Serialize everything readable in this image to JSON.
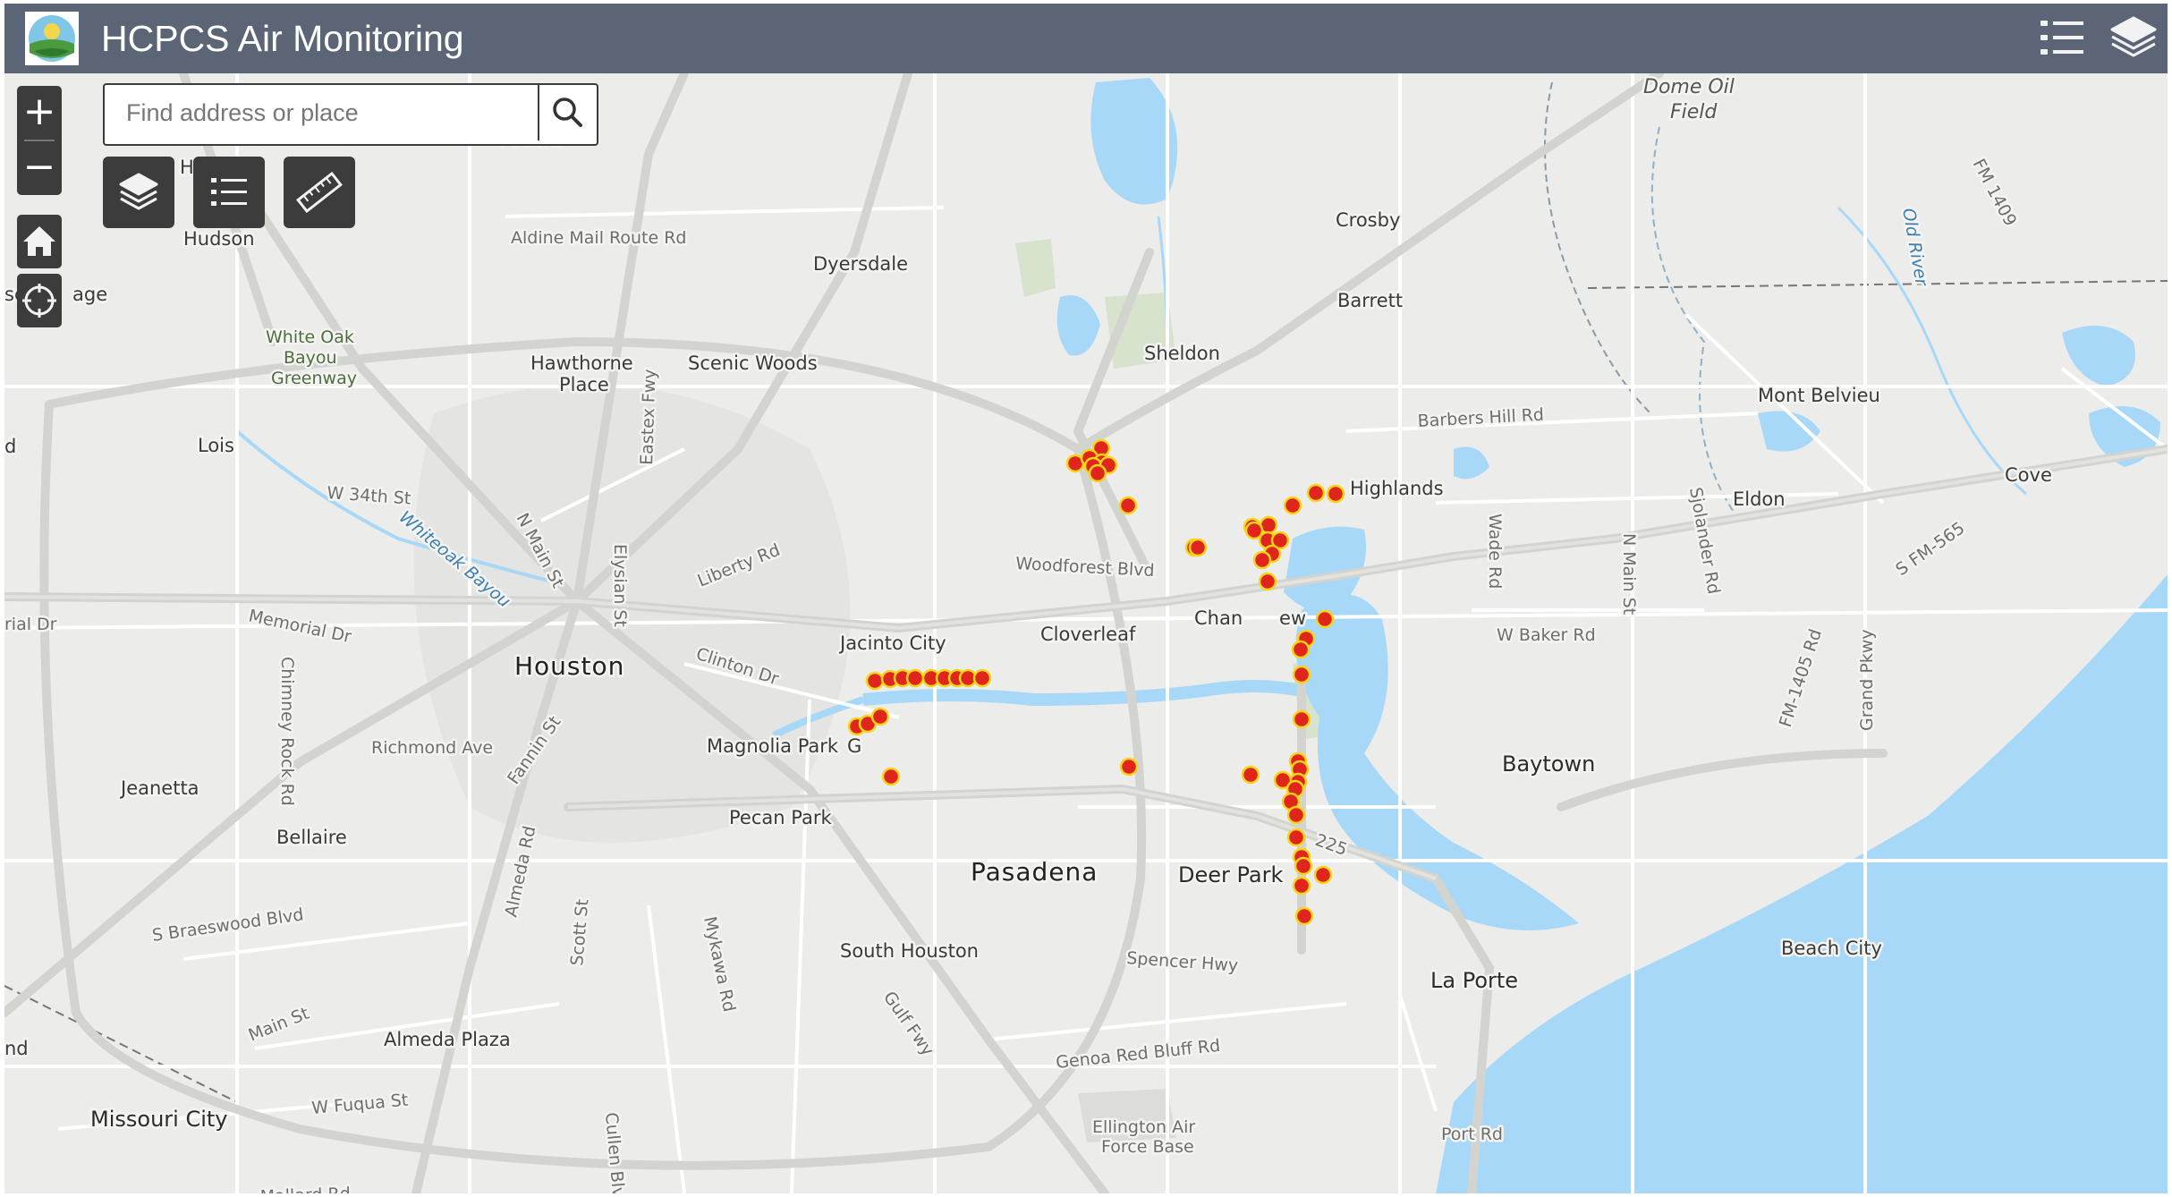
{
  "header": {
    "title": "HCPCS Air Monitoring",
    "bg_color": "#5b6576",
    "logo_icon": "hcpcs-logo",
    "legend_icon": "list-icon",
    "layers_icon": "layers-icon"
  },
  "search": {
    "placeholder": "Find address or place",
    "icon": "search-icon"
  },
  "zoom": {
    "in_label": "+",
    "out_label": "−"
  },
  "tools": [
    {
      "name": "layers",
      "icon": "layers-icon"
    },
    {
      "name": "legend",
      "icon": "list-icon"
    },
    {
      "name": "measure",
      "icon": "ruler-icon"
    }
  ],
  "nav": {
    "home_icon": "home-icon",
    "locate_icon": "locate-icon"
  },
  "map": {
    "marker_color": "#e0261c",
    "water_color": "#a8d8f8",
    "labels": {
      "houston": "Houston",
      "pasadena": "Pasadena",
      "deer_park": "Deer Park",
      "baytown": "Baytown",
      "la_porte": "La Porte",
      "hudson": "Hudson",
      "dyersdale": "Dyersdale",
      "crosby": "Crosby",
      "barrett": "Barrett",
      "sheldon": "Sheldon",
      "mont_belvieu": "Mont Belvieu",
      "highlands": "Highlands",
      "eldon": "Eldon",
      "cove": "Cove",
      "hawthorne": "Hawthorne",
      "place": "Place",
      "scenic_woods": "Scenic Woods",
      "lois": "Lois",
      "jacinto_city": "Jacinto City",
      "cloverleaf": "Cloverleaf",
      "channelview_a": "Chan",
      "channelview_b": "ew",
      "magnolia_park": "Magnolia Park",
      "magnolia_g": "G",
      "pecan_park": "Pecan Park",
      "jeanetta": "Jeanetta",
      "bellaire": "Bellaire",
      "south_houston": "South Houston",
      "almeda_plaza": "Almeda Plaza",
      "missouri_city": "Missouri City",
      "beach_city": "Beach City",
      "aldine": "Aldine",
      "h": "H",
      "sc": "sc",
      "age": "age",
      "d_edge": "d",
      "nd_edge": "nd",
      "rial_dr": "rial Dr",
      "white_oak_1": "White Oak",
      "white_oak_2": "Bayou",
      "white_oak_3": "Greenway",
      "ellington_1": "Ellington Air",
      "ellington_2": "Force Base",
      "dome_oil_1": "Dome Oil",
      "dome_oil_2": "Field",
      "aldine_mail": "Aldine Mail Route Rd",
      "w34": "W 34th St",
      "memorial": "Memorial Dr",
      "richmond": "Richmond Ave",
      "braeswood": "S Braeswood Blvd",
      "main_st": "Main St",
      "w_fuqua": "W Fuqua St",
      "liberty": "Liberty Rd",
      "clinton": "Clinton Dr",
      "woodforest": "Woodforest Blvd",
      "barbers": "Barbers Hill Rd",
      "w_baker": "W Baker Rd",
      "spencer": "Spencer Hwy",
      "genoa": "Genoa Red Bluff Rd",
      "port_rd": "Port Rd",
      "fm565": "S FM-565",
      "fm1405": "FM-1405 Rd",
      "fm1409": "FM 1409",
      "grand_pkwy": "Grand Pkwy",
      "wade": "Wade Rd",
      "n_main": "N Main St",
      "sjolander": "Sjolander Rd",
      "eastex": "Eastex Fwy",
      "n_main_st": "N Main St",
      "elysian": "Elysian St",
      "fannin": "Fannin St",
      "chimney": "Chimney Rock Rd",
      "almeda_rd": "Almeda Rd",
      "scott": "Scott St",
      "mykawa": "Mykawa Rd",
      "gulf_fwy": "Gulf Fwy",
      "cullen": "Cullen Blvd",
      "mallard": "Mallard Rd",
      "sh225": "225",
      "whiteoak_bayou": "Whiteoak Bayou",
      "old_river": "Old River"
    }
  }
}
